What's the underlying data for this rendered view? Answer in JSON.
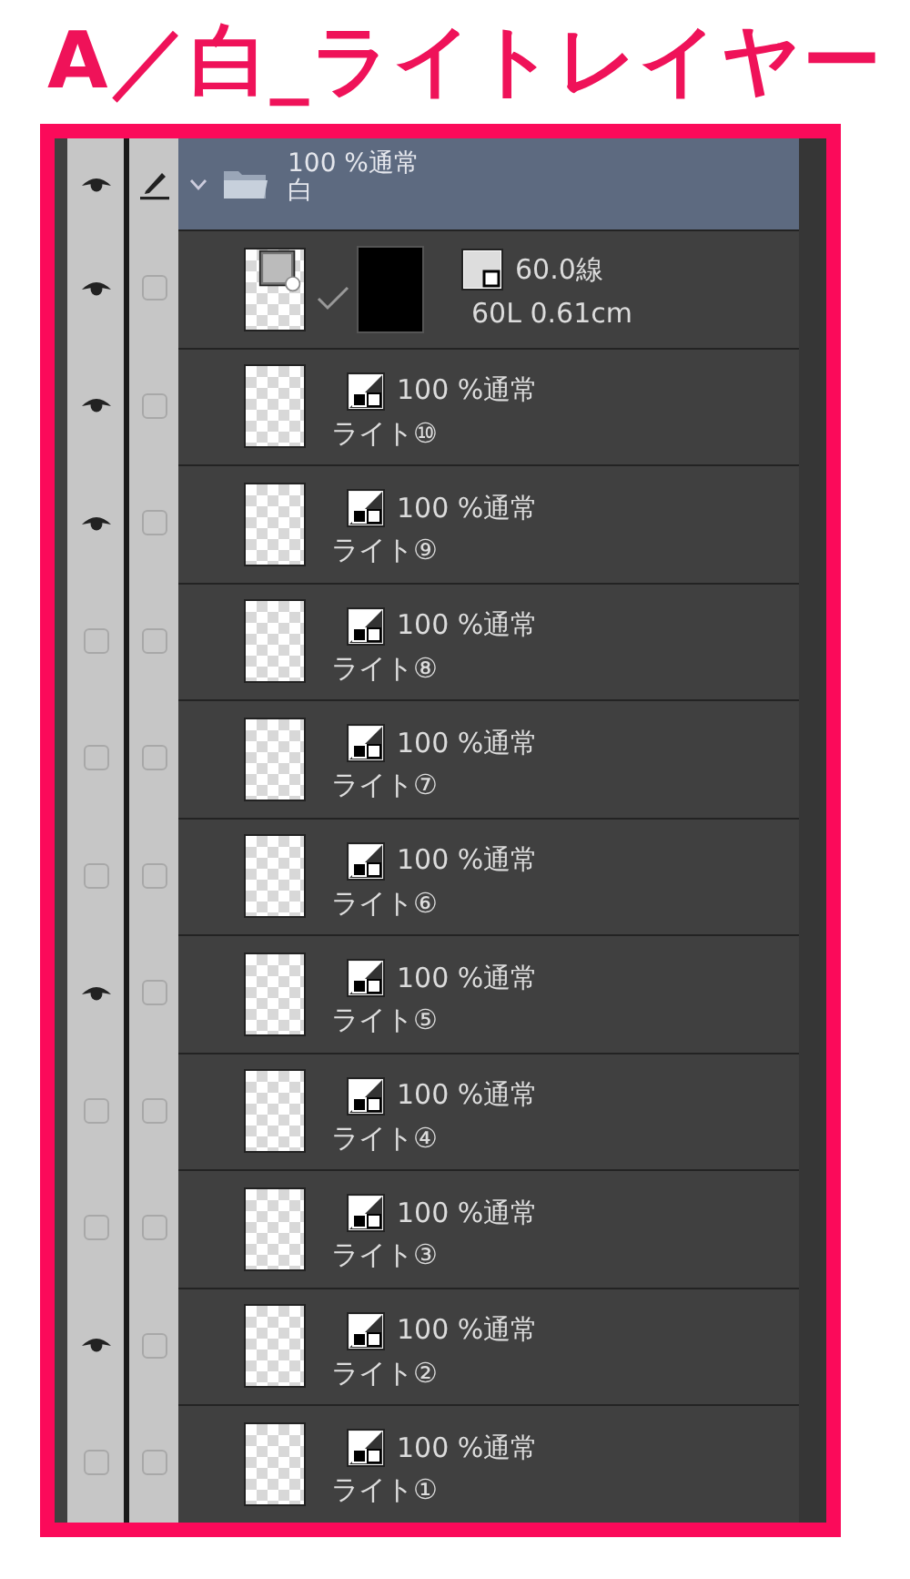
{
  "title": "A／白_ライトレイヤー",
  "group": {
    "opacity_blend": "100 %通常",
    "name": "白",
    "visible": true,
    "edit_target": true,
    "expanded": true,
    "selected": true
  },
  "ruler_layer": {
    "visible": true,
    "edit_target": false,
    "line_value": "60.0線",
    "line_detail": "60L 0.61cm"
  },
  "layers": [
    {
      "opacity_blend": "100 %通常",
      "name": "ライト⑩",
      "visible": true,
      "edit_target": false
    },
    {
      "opacity_blend": "100 %通常",
      "name": "ライト⑨",
      "visible": true,
      "edit_target": false
    },
    {
      "opacity_blend": "100 %通常",
      "name": "ライト⑧",
      "visible": false,
      "edit_target": false
    },
    {
      "opacity_blend": "100 %通常",
      "name": "ライト⑦",
      "visible": false,
      "edit_target": false
    },
    {
      "opacity_blend": "100 %通常",
      "name": "ライト⑥",
      "visible": false,
      "edit_target": false
    },
    {
      "opacity_blend": "100 %通常",
      "name": "ライト⑤",
      "visible": true,
      "edit_target": false
    },
    {
      "opacity_blend": "100 %通常",
      "name": "ライト④",
      "visible": false,
      "edit_target": false
    },
    {
      "opacity_blend": "100 %通常",
      "name": "ライト③",
      "visible": false,
      "edit_target": false
    },
    {
      "opacity_blend": "100 %通常",
      "name": "ライト②",
      "visible": true,
      "edit_target": false
    },
    {
      "opacity_blend": "100 %通常",
      "name": "ライト①",
      "visible": false,
      "edit_target": false
    }
  ]
}
